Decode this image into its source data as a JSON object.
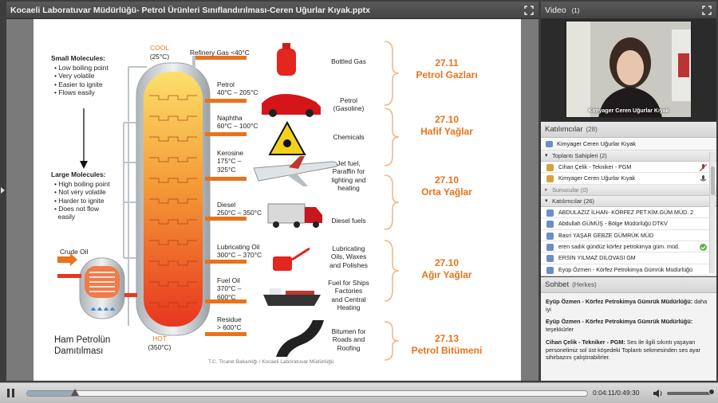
{
  "share": {
    "title": "Kocaeli Laboratuvar Müdürlüğü- Petrol Ürünleri Sınıflandırılması-Ceren Uğurlar Kıyak.pptx"
  },
  "slide": {
    "small_molecules_title": "Small Molecules:",
    "small_bullets": [
      "Low boiling point",
      "Very volatile",
      "Easier to ignite",
      "Flows easily"
    ],
    "large_molecules_title": "Large Molecules:",
    "large_bullets": [
      "High boiling point",
      "Not very volatile",
      "Harder to ignite",
      "Does not flow",
      "easily"
    ],
    "cool": "COOL",
    "cool_temp": "(25°C)",
    "hot": "HOT",
    "hot_temp": "(350°C)",
    "crude_oil": "Crude Oil",
    "caption_line1": "Ham Petrolün",
    "caption_line2": "Damıtılması",
    "footer": "T.C. Ticaret Bakanlığı / Kocaeli Laboratuvar Müdürlüğü",
    "fractions": [
      {
        "name": "Refinery Gas  <40°C",
        "product": "Bottled Gas"
      },
      {
        "name": "Petrol\n40°C – 205°C",
        "product": "Petrol\n(Gasoline)"
      },
      {
        "name": "Naphtha\n60°C – 100°C",
        "product": "Chemicals"
      },
      {
        "name": "Kerosine\n175°C –\n325°C",
        "product": "Jet fuel,\nParaffin for\nlighting and\nheating"
      },
      {
        "name": "Diesel\n250°C – 350°C",
        "product": "Diesel fuels"
      },
      {
        "name": "Lubricating Oil\n300°C – 370°C",
        "product": "Lubricating\nOils, Waxes\nand Polishes"
      },
      {
        "name": "Fuel Oil\n370°C –\n600°C",
        "product": "Fuel for Ships\nFactories\nand Central\nHeating"
      },
      {
        "name": "Residue\n> 600°C",
        "product": "Bitumen for\nRoads and\nRoofing"
      }
    ],
    "groups": [
      {
        "code": "27.11",
        "label": "Petrol Gazları"
      },
      {
        "code": "27.10",
        "label": "Hafif Yağlar"
      },
      {
        "code": "27.10",
        "label": "Orta Yağlar"
      },
      {
        "code": "27.10",
        "label": "Ağır Yağlar"
      },
      {
        "code": "27.13",
        "label": "Petrol Bitümeni"
      }
    ]
  },
  "video": {
    "title": "Video",
    "count": "(1)",
    "speaker": "Kimyager Ceren Uğurlar Kıyak"
  },
  "attendees": {
    "title": "Katılımcılar",
    "count": "(28)",
    "me": "Kimyager Ceren Uğurlar Kıyak",
    "hosts_group": "Toplantı Sahipleri (2)",
    "hosts": [
      "Cihan Çelik - Tekniker - PGM",
      "Kimyager Ceren Uğurlar Kıyak"
    ],
    "presenters_group": "Sunucular (0)",
    "participants_group": "Katılımcılar (26)",
    "participants": [
      "ABDULAZİZ İLHAN- KÖRFEZ PET.KİM.GÜM.MÜD. 2",
      "Abdullah GÜMÜŞ - Bölge Müdürlüğü DTKV",
      "Basri YAŞAR GEBZE GÜMRÜK MÜD",
      "eren sadık gündüz körfez petrokimya güm. müd.",
      "ERSİN YILMAZ DİLOVASI GM",
      "Eyüp Özmen - Körfez Petrokimya Gümrük Müdürlüğü"
    ]
  },
  "chat": {
    "title": "Sohbet",
    "scope": "(Herkes)",
    "messages": [
      {
        "who": "Eyüp Özmen - Körfez Petrokimya Gümrük Müdürlüğü:",
        "text": " daha iyi"
      },
      {
        "who": "Eyüp Özmen - Körfez Petrokimya Gümrük Müdürlüğü:",
        "text": " teşekkürler"
      },
      {
        "who": "Cihan Çelik - Tekniker - PGM:",
        "text": " Ses ile ilgili sıkıntı yaşayan personelimiz sol üst köşedeki Toplantı sekmesinden ses ayar sihirbazını çalıştırabilirler."
      }
    ]
  },
  "playback": {
    "time": "0:04:11/0:49:30",
    "progress": 0.085
  },
  "colors": {
    "accent_orange": "#e8731a",
    "bracket": "#f0b78a",
    "column_top": "#f7c653",
    "column_bottom": "#e8361f"
  }
}
